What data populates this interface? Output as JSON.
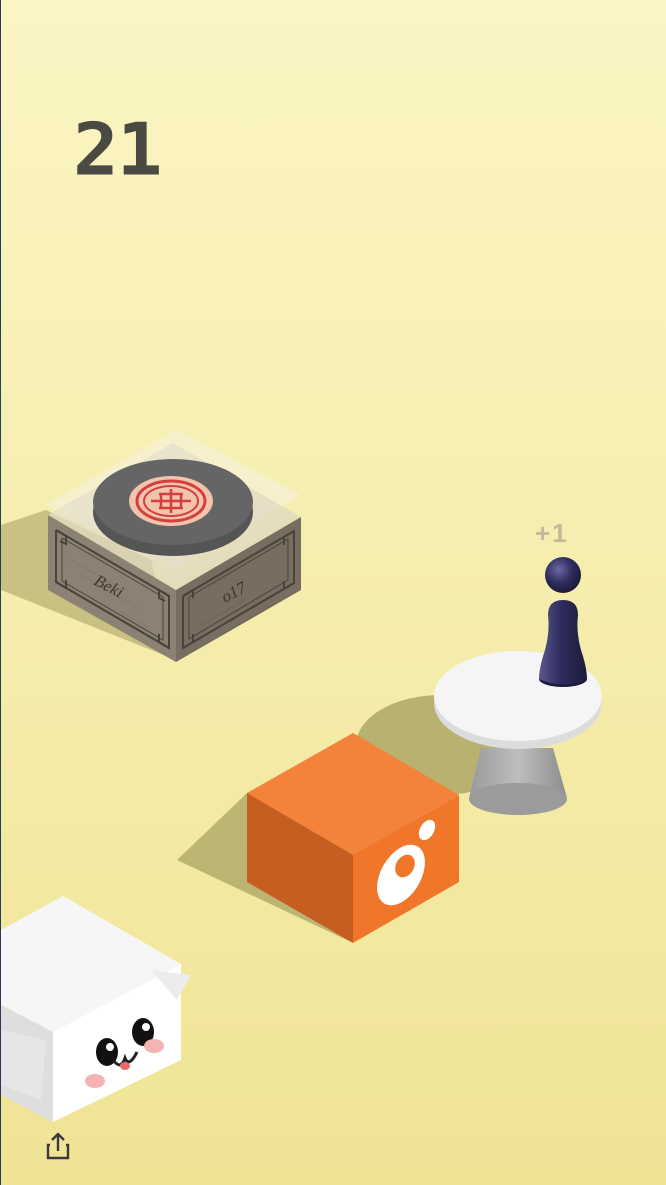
{
  "hud": {
    "score": "21",
    "bonus_popup": "+1"
  },
  "box": {
    "engraving_left": "Beki",
    "engraving_right": "o17"
  },
  "icons": {
    "share": "share-icon"
  },
  "colors": {
    "background_top": "#fbf5c4",
    "background_bottom": "#efe494",
    "score_text": "#4a4a42",
    "orange_cube": "#f08030",
    "player_piece": "#2e2c5c"
  }
}
